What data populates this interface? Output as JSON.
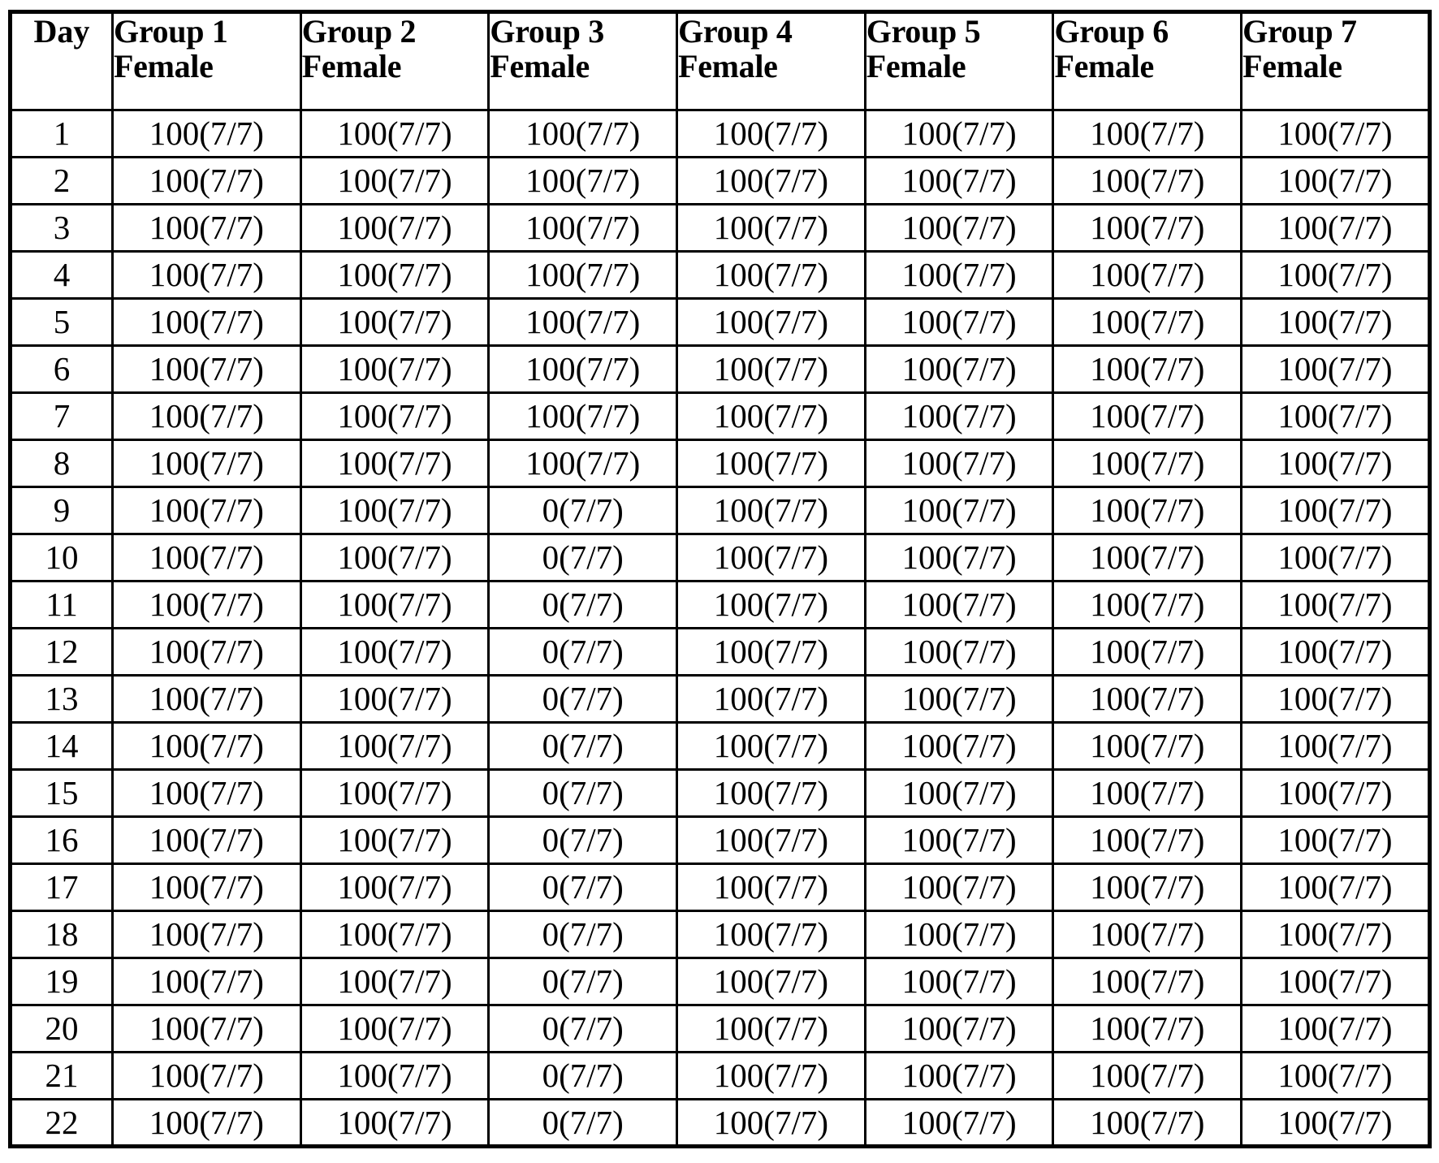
{
  "table": {
    "caption": "",
    "columns": [
      {
        "key": "day",
        "line1": "Day",
        "line2": "",
        "align": "center"
      },
      {
        "key": "group1",
        "line1": "Group 1",
        "line2": "Female",
        "align": "left"
      },
      {
        "key": "group2",
        "line1": "Group 2",
        "line2": "Female",
        "align": "left"
      },
      {
        "key": "group3",
        "line1": "Group 3",
        "line2": "Female",
        "align": "left"
      },
      {
        "key": "group4",
        "line1": "Group 4",
        "line2": "Female",
        "align": "left"
      },
      {
        "key": "group5",
        "line1": "Group 5",
        "line2": "Female",
        "align": "left"
      },
      {
        "key": "group6",
        "line1": "Group 6",
        "line2": "Female",
        "align": "left"
      },
      {
        "key": "group7",
        "line1": "Group 7",
        "line2": "Female",
        "align": "left"
      }
    ],
    "rows": [
      {
        "day": "1",
        "values": [
          "100(7/7)",
          "100(7/7)",
          "100(7/7)",
          "100(7/7)",
          "100(7/7)",
          "100(7/7)",
          "100(7/7)"
        ]
      },
      {
        "day": "2",
        "values": [
          "100(7/7)",
          "100(7/7)",
          "100(7/7)",
          "100(7/7)",
          "100(7/7)",
          "100(7/7)",
          "100(7/7)"
        ]
      },
      {
        "day": "3",
        "values": [
          "100(7/7)",
          "100(7/7)",
          "100(7/7)",
          "100(7/7)",
          "100(7/7)",
          "100(7/7)",
          "100(7/7)"
        ]
      },
      {
        "day": "4",
        "values": [
          "100(7/7)",
          "100(7/7)",
          "100(7/7)",
          "100(7/7)",
          "100(7/7)",
          "100(7/7)",
          "100(7/7)"
        ]
      },
      {
        "day": "5",
        "values": [
          "100(7/7)",
          "100(7/7)",
          "100(7/7)",
          "100(7/7)",
          "100(7/7)",
          "100(7/7)",
          "100(7/7)"
        ]
      },
      {
        "day": "6",
        "values": [
          "100(7/7)",
          "100(7/7)",
          "100(7/7)",
          "100(7/7)",
          "100(7/7)",
          "100(7/7)",
          "100(7/7)"
        ]
      },
      {
        "day": "7",
        "values": [
          "100(7/7)",
          "100(7/7)",
          "100(7/7)",
          "100(7/7)",
          "100(7/7)",
          "100(7/7)",
          "100(7/7)"
        ]
      },
      {
        "day": "8",
        "values": [
          "100(7/7)",
          "100(7/7)",
          "100(7/7)",
          "100(7/7)",
          "100(7/7)",
          "100(7/7)",
          "100(7/7)"
        ]
      },
      {
        "day": "9",
        "values": [
          "100(7/7)",
          "100(7/7)",
          "0(7/7)",
          "100(7/7)",
          "100(7/7)",
          "100(7/7)",
          "100(7/7)"
        ]
      },
      {
        "day": "10",
        "values": [
          "100(7/7)",
          "100(7/7)",
          "0(7/7)",
          "100(7/7)",
          "100(7/7)",
          "100(7/7)",
          "100(7/7)"
        ]
      },
      {
        "day": "11",
        "values": [
          "100(7/7)",
          "100(7/7)",
          "0(7/7)",
          "100(7/7)",
          "100(7/7)",
          "100(7/7)",
          "100(7/7)"
        ]
      },
      {
        "day": "12",
        "values": [
          "100(7/7)",
          "100(7/7)",
          "0(7/7)",
          "100(7/7)",
          "100(7/7)",
          "100(7/7)",
          "100(7/7)"
        ]
      },
      {
        "day": "13",
        "values": [
          "100(7/7)",
          "100(7/7)",
          "0(7/7)",
          "100(7/7)",
          "100(7/7)",
          "100(7/7)",
          "100(7/7)"
        ]
      },
      {
        "day": "14",
        "values": [
          "100(7/7)",
          "100(7/7)",
          "0(7/7)",
          "100(7/7)",
          "100(7/7)",
          "100(7/7)",
          "100(7/7)"
        ]
      },
      {
        "day": "15",
        "values": [
          "100(7/7)",
          "100(7/7)",
          "0(7/7)",
          "100(7/7)",
          "100(7/7)",
          "100(7/7)",
          "100(7/7)"
        ]
      },
      {
        "day": "16",
        "values": [
          "100(7/7)",
          "100(7/7)",
          "0(7/7)",
          "100(7/7)",
          "100(7/7)",
          "100(7/7)",
          "100(7/7)"
        ]
      },
      {
        "day": "17",
        "values": [
          "100(7/7)",
          "100(7/7)",
          "0(7/7)",
          "100(7/7)",
          "100(7/7)",
          "100(7/7)",
          "100(7/7)"
        ]
      },
      {
        "day": "18",
        "values": [
          "100(7/7)",
          "100(7/7)",
          "0(7/7)",
          "100(7/7)",
          "100(7/7)",
          "100(7/7)",
          "100(7/7)"
        ]
      },
      {
        "day": "19",
        "values": [
          "100(7/7)",
          "100(7/7)",
          "0(7/7)",
          "100(7/7)",
          "100(7/7)",
          "100(7/7)",
          "100(7/7)"
        ]
      },
      {
        "day": "20",
        "values": [
          "100(7/7)",
          "100(7/7)",
          "0(7/7)",
          "100(7/7)",
          "100(7/7)",
          "100(7/7)",
          "100(7/7)"
        ]
      },
      {
        "day": "21",
        "values": [
          "100(7/7)",
          "100(7/7)",
          "0(7/7)",
          "100(7/7)",
          "100(7/7)",
          "100(7/7)",
          "100(7/7)"
        ]
      },
      {
        "day": "22",
        "values": [
          "100(7/7)",
          "100(7/7)",
          "0(7/7)",
          "100(7/7)",
          "100(7/7)",
          "100(7/7)",
          "100(7/7)"
        ]
      }
    ]
  },
  "style": {
    "text_color": "#000000",
    "background_color": "#ffffff",
    "border_color": "#000000"
  }
}
